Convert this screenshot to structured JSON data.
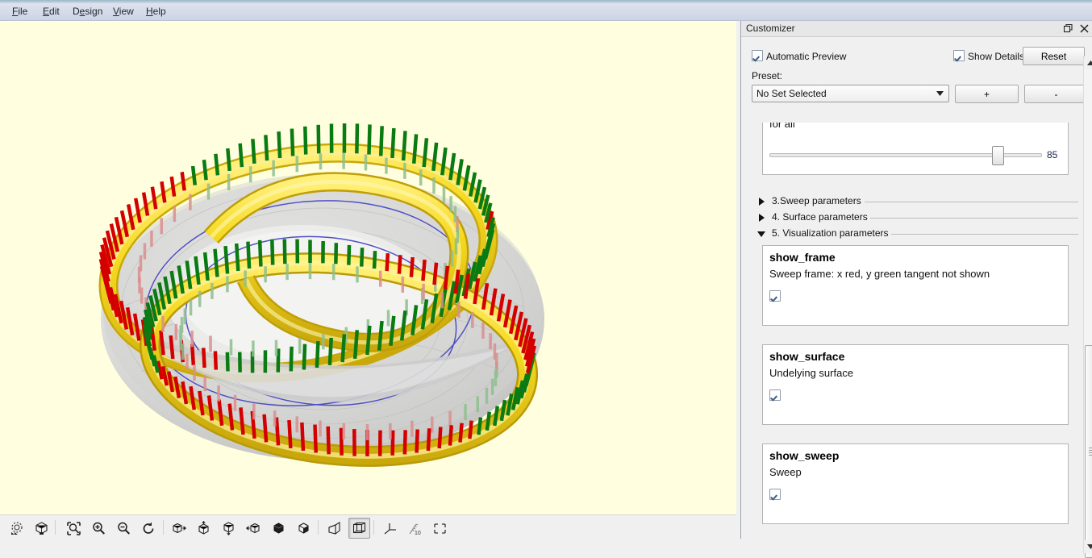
{
  "menu": {
    "items": [
      {
        "label": "File",
        "mnemonic": "F"
      },
      {
        "label": "Edit",
        "mnemonic": "E"
      },
      {
        "label": "Design",
        "mnemonic": "D"
      },
      {
        "label": "View",
        "mnemonic": "V"
      },
      {
        "label": "Help",
        "mnemonic": "H"
      }
    ]
  },
  "viewport": {
    "background_color": "#ffffe0",
    "model_description": "3D torus-knot sweep: yellow swept tube following a knot on a grey translucent torus surface, with red and green frame vectors and a blue guide curve",
    "colors": {
      "sweep": "#f2d21e",
      "sweep_shadow": "#c9a810",
      "surface": "#d2d2d2",
      "frame_x": "#d40000",
      "frame_y": "#0a7a12",
      "curve": "#4040c0"
    }
  },
  "toolbar": {
    "buttons": [
      {
        "name": "animate-rotate-icon",
        "tooltip": "Animate"
      },
      {
        "name": "view-all-icon",
        "tooltip": "View All"
      },
      {
        "name": "zoom-fit-icon",
        "tooltip": "Zoom Fit"
      },
      {
        "name": "zoom-in-icon",
        "tooltip": "Zoom In"
      },
      {
        "name": "zoom-out-icon",
        "tooltip": "Zoom Out"
      },
      {
        "name": "reset-view-icon",
        "tooltip": "Reset View"
      },
      {
        "name": "view-right-icon",
        "tooltip": "Right View"
      },
      {
        "name": "view-top-icon",
        "tooltip": "Top View"
      },
      {
        "name": "view-bottom-icon",
        "tooltip": "Bottom View"
      },
      {
        "name": "view-left-icon",
        "tooltip": "Left View"
      },
      {
        "name": "view-front-icon",
        "tooltip": "Front View"
      },
      {
        "name": "view-back-icon",
        "tooltip": "Back View"
      },
      {
        "name": "perspective-icon",
        "tooltip": "Perspective"
      },
      {
        "name": "orthographic-icon",
        "tooltip": "Orthographic",
        "selected": true
      },
      {
        "name": "show-axes-icon",
        "tooltip": "Show Axes"
      },
      {
        "name": "show-scale-icon",
        "tooltip": "Show Scale Markers"
      },
      {
        "name": "show-crosshairs-icon",
        "tooltip": "Show Crosshairs"
      }
    ]
  },
  "customizer": {
    "title": "Customizer",
    "float_button": "float-icon",
    "close_button": "close-icon",
    "automatic_preview": {
      "label": "Automatic Preview",
      "checked": true
    },
    "show_details": {
      "label": "Show Details",
      "checked": true
    },
    "reset_button": "Reset",
    "preset": {
      "label": "Preset:",
      "value": "No Set Selected",
      "add_button": "+",
      "remove_button": "-"
    },
    "clipped_param": {
      "label": "for all",
      "slider_value": "85",
      "slider_percent": 85
    },
    "sections": [
      {
        "label": "3.Sweep parameters",
        "expanded": false
      },
      {
        "label": "4. Surface parameters",
        "expanded": false
      },
      {
        "label": "5. Visualization parameters",
        "expanded": true
      }
    ],
    "parameters": [
      {
        "name": "show_frame",
        "description": "Sweep frame: x red, y green tangent not shown",
        "checked": true
      },
      {
        "name": "show_surface",
        "description": "Undelying surface",
        "checked": true
      },
      {
        "name": "show_sweep",
        "description": "Sweep",
        "checked": true
      }
    ]
  }
}
